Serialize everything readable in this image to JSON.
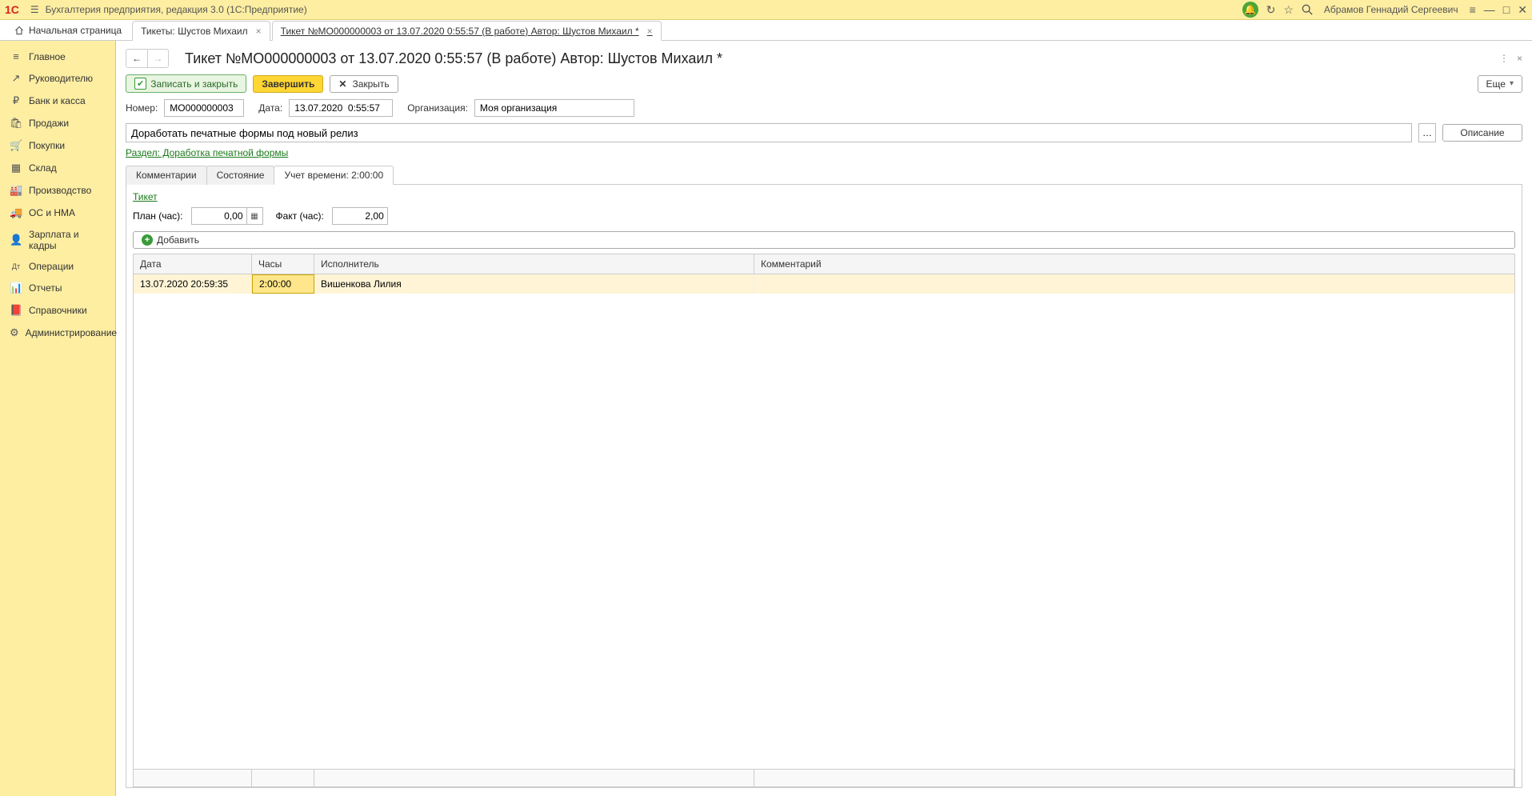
{
  "topbar": {
    "app_title": "Бухгалтерия предприятия, редакция 3.0  (1С:Предприятие)",
    "user_name": "Абрамов Геннадий Сергеевич"
  },
  "tabs": {
    "home": "Начальная страница",
    "items": [
      {
        "label": "Тикеты: Шустов Михаил"
      },
      {
        "label": "Тикет №МО000000003 от 13.07.2020 0:55:57 (В работе) Автор: Шустов Михаил *",
        "active": true
      }
    ]
  },
  "sidebar": {
    "items": [
      {
        "label": "Главное",
        "icon": "≡"
      },
      {
        "label": "Руководителю",
        "icon": "↗"
      },
      {
        "label": "Банк и касса",
        "icon": "₽"
      },
      {
        "label": "Продажи",
        "icon": "🛍"
      },
      {
        "label": "Покупки",
        "icon": "🛒"
      },
      {
        "label": "Склад",
        "icon": "▦"
      },
      {
        "label": "Производство",
        "icon": "🏭"
      },
      {
        "label": "ОС и НМА",
        "icon": "🚚"
      },
      {
        "label": "Зарплата и кадры",
        "icon": "👤"
      },
      {
        "label": "Операции",
        "icon": "Дт"
      },
      {
        "label": "Отчеты",
        "icon": "📊"
      },
      {
        "label": "Справочники",
        "icon": "📕"
      },
      {
        "label": "Администрирование",
        "icon": "⚙"
      }
    ]
  },
  "page": {
    "title": "Тикет №МО000000003 от 13.07.2020 0:55:57 (В работе) Автор: Шустов Михаил *",
    "toolbar": {
      "save_close": "Записать и закрыть",
      "complete": "Завершить",
      "close": "Закрыть",
      "more": "Еще"
    },
    "fields": {
      "number_label": "Номер:",
      "number": "МО000000003",
      "date_label": "Дата:",
      "date": "13.07.2020  0:55:57",
      "org_label": "Организация:",
      "org": "Моя организация",
      "subject": "Доработать печатные формы под новый релиз",
      "desc_btn": "Описание",
      "section_link": "Раздел: Доработка печатной формы"
    },
    "inner_tabs": [
      {
        "label": "Комментарии"
      },
      {
        "label": "Состояние"
      },
      {
        "label": "Учет времени: 2:00:00",
        "active": true
      }
    ],
    "time_tab": {
      "ticket_link": "Тикет",
      "plan_label": "План (час):",
      "plan_value": "0,00",
      "fact_label": "Факт (час):",
      "fact_value": "2,00",
      "add_btn": "Добавить",
      "columns": {
        "date": "Дата",
        "hours": "Часы",
        "executor": "Исполнитель",
        "comment": "Комментарий"
      },
      "rows": [
        {
          "date": "13.07.2020 20:59:35",
          "hours": "2:00:00",
          "executor": "Вишенкова Лилия",
          "comment": ""
        }
      ]
    }
  }
}
